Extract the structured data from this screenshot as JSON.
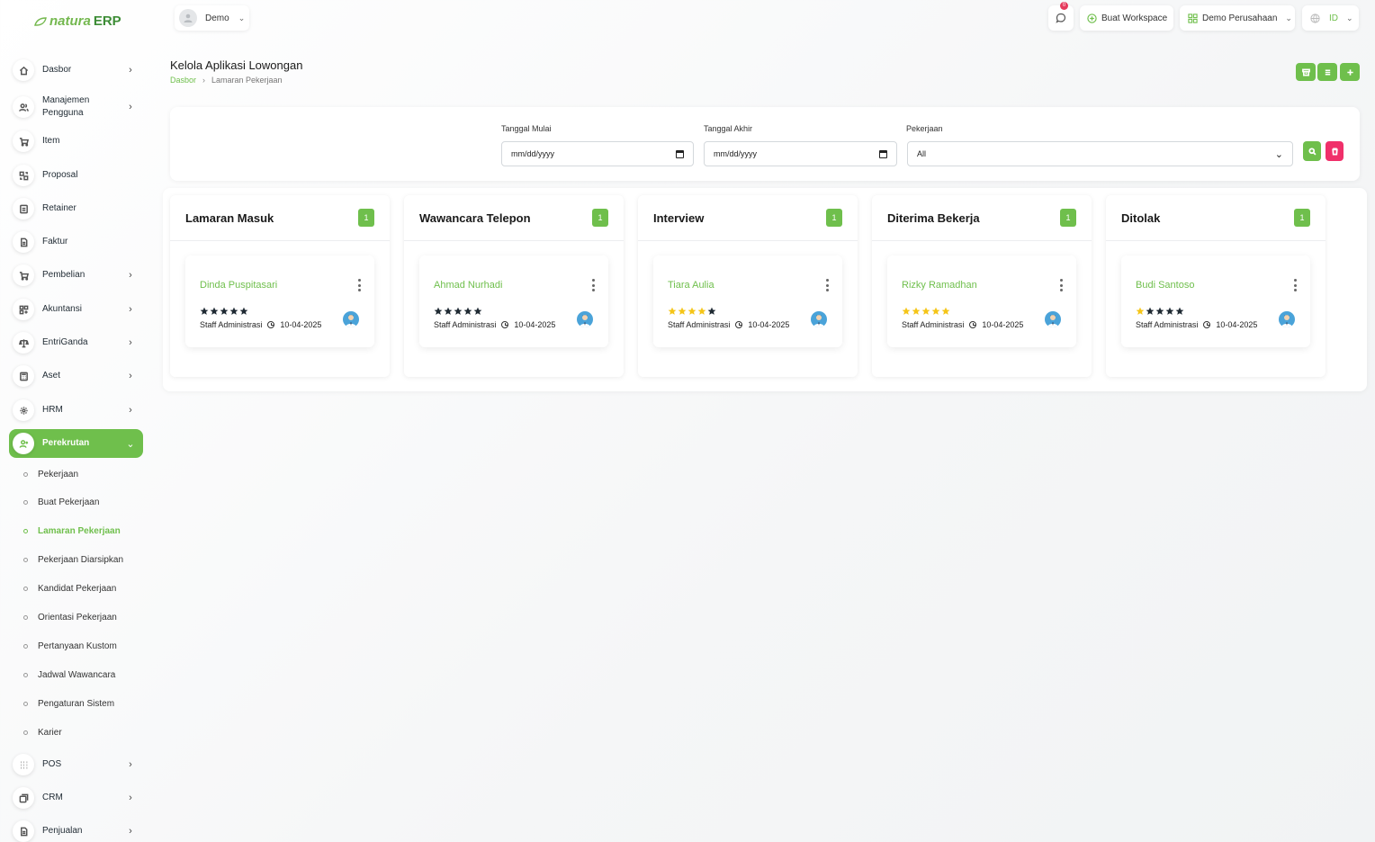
{
  "brand": {
    "part1": "natura",
    "part2": "ERP"
  },
  "topbar": {
    "user": "Demo",
    "notif_count": "0",
    "create_workspace": "Buat Workspace",
    "company": "Demo Perusahaan",
    "language": "ID"
  },
  "sidebar": {
    "items": [
      {
        "label": "Dasbor",
        "icon": "home-icon"
      },
      {
        "label": "Manajemen Pengguna",
        "icon": "users-icon"
      },
      {
        "label": "Item",
        "icon": "cart-icon"
      },
      {
        "label": "Proposal",
        "icon": "proposal-icon"
      },
      {
        "label": "Retainer",
        "icon": "retainer-icon"
      },
      {
        "label": "Faktur",
        "icon": "invoice-icon"
      },
      {
        "label": "Pembelian",
        "icon": "cart-icon"
      },
      {
        "label": "Akuntansi",
        "icon": "grid-icon"
      },
      {
        "label": "EntriGanda",
        "icon": "scale-icon"
      },
      {
        "label": "Aset",
        "icon": "calculator-icon"
      },
      {
        "label": "HRM",
        "icon": "hrm-icon"
      },
      {
        "label": "Perekrutan",
        "icon": "user-plus-icon"
      },
      {
        "label": "POS",
        "icon": "dots-grid-icon"
      },
      {
        "label": "CRM",
        "icon": "layers-icon"
      },
      {
        "label": "Penjualan",
        "icon": "document-icon"
      }
    ],
    "sub_items": [
      "Pekerjaan",
      "Buat Pekerjaan",
      "Lamaran Pekerjaan",
      "Pekerjaan Diarsipkan",
      "Kandidat Pekerjaan",
      "Orientasi Pekerjaan",
      "Pertanyaan Kustom",
      "Jadwal Wawancara",
      "Pengaturan Sistem",
      "Karier"
    ]
  },
  "page": {
    "title": "Kelola Aplikasi Lowongan",
    "breadcrumb_home": "Dasbor",
    "breadcrumb_current": "Lamaran Pekerjaan"
  },
  "filters": {
    "start_label": "Tanggal Mulai",
    "start_value": "mm/dd/yyyy",
    "end_label": "Tanggal Akhir",
    "end_value": "mm/dd/yyyy",
    "job_label": "Pekerjaan",
    "job_value": "All"
  },
  "colors": {
    "accent": "#6fbf4c",
    "danger": "#f0306a",
    "star_dark": "#1f2a33",
    "star_gold": "#f5c518"
  },
  "columns": [
    {
      "title": "Lamaran Masuk",
      "count": "1",
      "card": {
        "name": "Dinda Puspitasari",
        "rating": 0,
        "job": "Staff Administrasi",
        "date": "10-04-2025"
      }
    },
    {
      "title": "Wawancara Telepon",
      "count": "1",
      "card": {
        "name": "Ahmad Nurhadi",
        "rating": 0,
        "job": "Staff Administrasi",
        "date": "10-04-2025"
      }
    },
    {
      "title": "Interview",
      "count": "1",
      "card": {
        "name": "Tiara Aulia",
        "rating": 4,
        "job": "Staff Administrasi",
        "date": "10-04-2025"
      }
    },
    {
      "title": "Diterima Bekerja",
      "count": "1",
      "card": {
        "name": "Rizky Ramadhan",
        "rating": 5,
        "job": "Staff Administrasi",
        "date": "10-04-2025"
      }
    },
    {
      "title": "Ditolak",
      "count": "1",
      "card": {
        "name": "Budi Santoso",
        "rating": 1,
        "job": "Staff Administrasi",
        "date": "10-04-2025"
      }
    }
  ]
}
